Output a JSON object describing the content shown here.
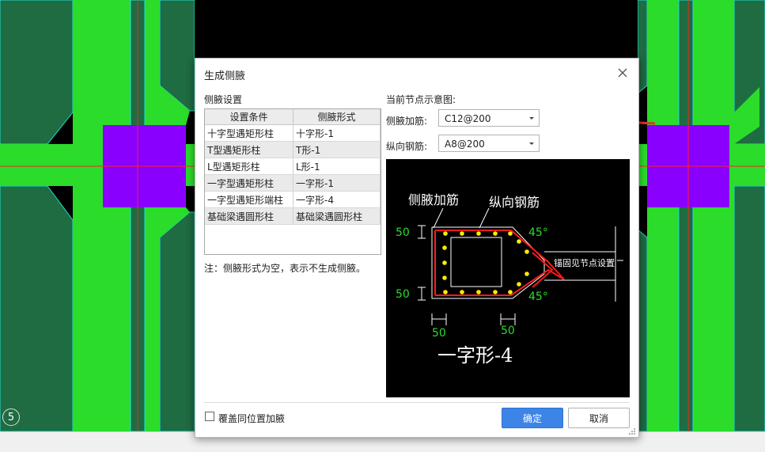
{
  "cad": {
    "marker": "5"
  },
  "dialog": {
    "title": "生成侧腋",
    "left_section": "侧腋设置",
    "right_section": "当前节点示意图:",
    "table": {
      "headers": [
        "设置条件",
        "侧腋形式"
      ],
      "rows": [
        [
          "十字型遇矩形柱",
          "十字形-1"
        ],
        [
          "T型遇矩形柱",
          "T形-1"
        ],
        [
          "L型遇矩形柱",
          "L形-1"
        ],
        [
          "一字型遇矩形柱",
          "一字形-1"
        ],
        [
          "一字型遇矩形端柱",
          "一字形-4"
        ],
        [
          "基础梁遇圆形柱",
          "基础梁遇圆形柱"
        ]
      ]
    },
    "note": "注：侧腋形式为空，表示不生成侧腋。",
    "haunch_rebar_label": "侧腋加筋:",
    "haunch_rebar_value": "C12@200",
    "long_rebar_label": "纵向钢筋:",
    "long_rebar_value": "A8@200",
    "preview": {
      "label_haunch": "侧腋加筋",
      "label_long": "纵向钢筋",
      "dim_50": "50",
      "angle_45": "45°",
      "anchor_note": "锚固见节点设置",
      "type_name": "一字形-4"
    },
    "overwrite_label": "覆盖同位置加腋",
    "ok_label": "确定",
    "cancel_label": "取消"
  },
  "colors": {
    "cad_green": "#2bdc2b",
    "cad_dark_green": "#1f6b42",
    "column_purple": "#8a00ff",
    "axis_red": "#ff2020",
    "primary_blue": "#3c85e6",
    "annotation_arrow": "#e8302a"
  }
}
